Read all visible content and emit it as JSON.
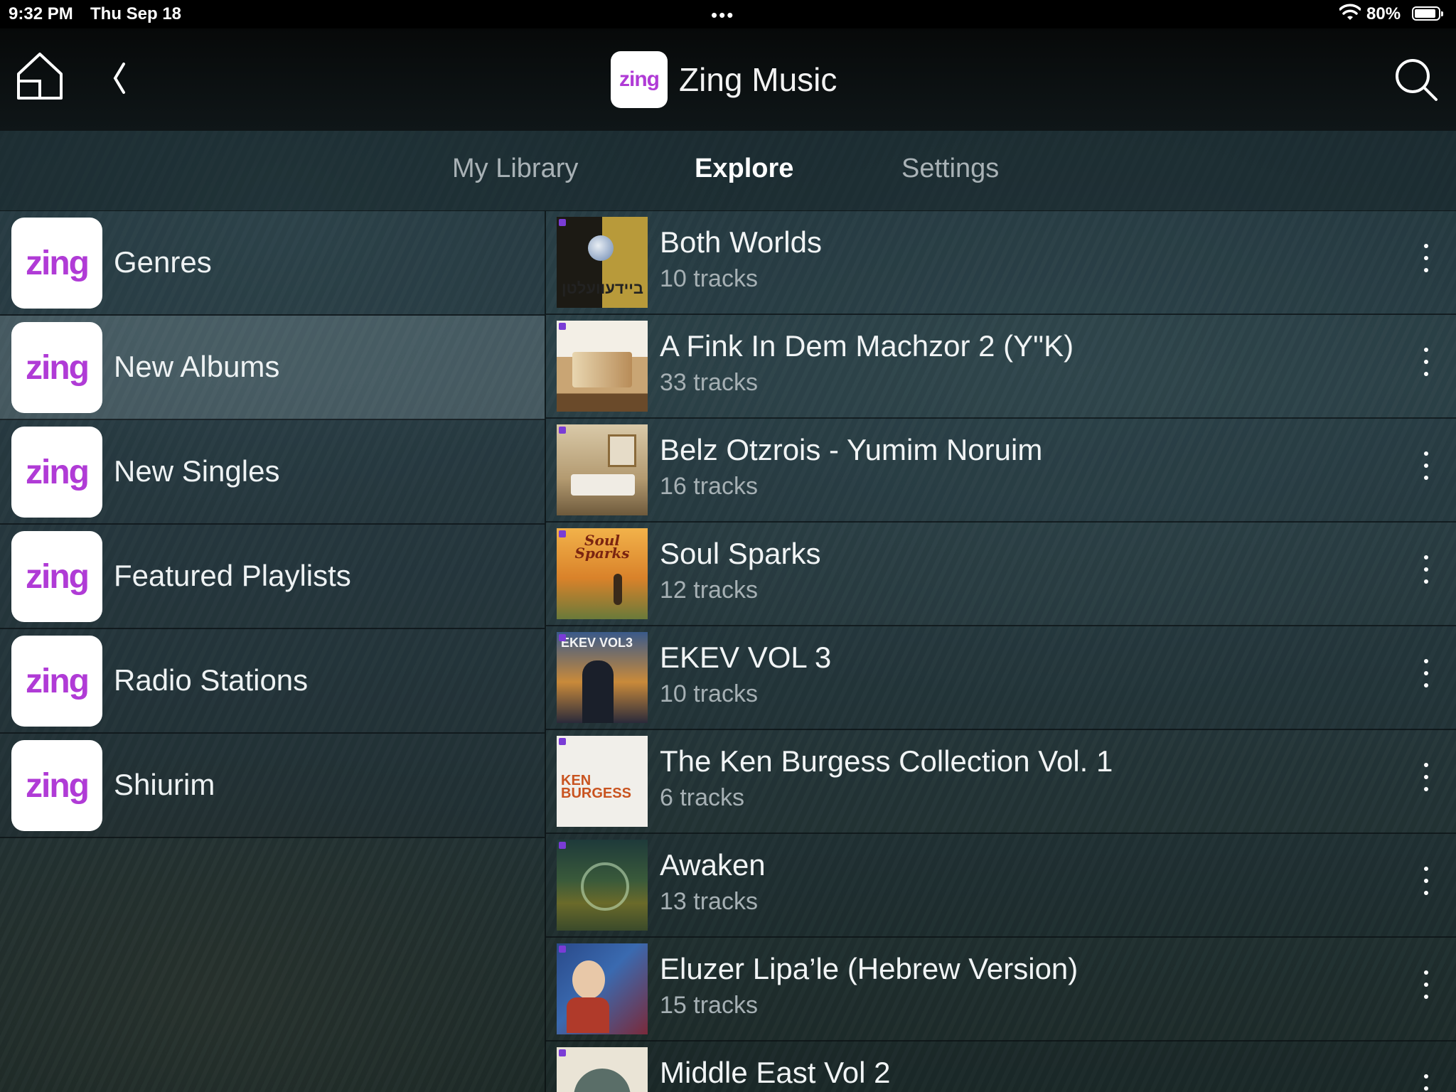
{
  "status_bar": {
    "time": "9:32 PM",
    "date": "Thu Sep 18",
    "dots": "•••",
    "battery": "80%"
  },
  "header": {
    "logo_text": "zing",
    "title": "Zing Music"
  },
  "tabs": [
    {
      "label": "My Library",
      "active": false
    },
    {
      "label": "Explore",
      "active": true
    },
    {
      "label": "Settings",
      "active": false
    }
  ],
  "categories": [
    {
      "logo": "zing",
      "label": "Genres"
    },
    {
      "logo": "zing",
      "label": "New Albums",
      "selected": true
    },
    {
      "logo": "zing",
      "label": "New Singles"
    },
    {
      "logo": "zing",
      "label": "Featured Playlists"
    },
    {
      "logo": "zing",
      "label": "Radio Stations"
    },
    {
      "logo": "zing",
      "label": "Shiurim"
    }
  ],
  "albums": [
    {
      "title": "Both Worlds",
      "tracks": "10 tracks",
      "cover_text": "ביידעוועלטן"
    },
    {
      "title": "A Fink In Dem Machzor 2 (Y\"K)",
      "tracks": "33 tracks",
      "cover_text": ""
    },
    {
      "title": "Belz Otzrois - Yumim Noruim",
      "tracks": "16 tracks",
      "cover_text": ""
    },
    {
      "title": "Soul Sparks",
      "tracks": "12 tracks",
      "cover_text": "Soul Sparks"
    },
    {
      "title": "EKEV VOL 3",
      "tracks": "10 tracks",
      "cover_text": "EKEV VOL3"
    },
    {
      "title": "The Ken Burgess Collection Vol. 1",
      "tracks": "6 tracks",
      "cover_text": "KEN BURGESS"
    },
    {
      "title": "Awaken",
      "tracks": "13 tracks",
      "cover_text": ""
    },
    {
      "title": "Eluzer Lipa’le (Hebrew Version)",
      "tracks": "15 tracks",
      "cover_text": ""
    },
    {
      "title": "Middle East Vol 2",
      "tracks": "",
      "cover_text": ""
    }
  ],
  "colors": {
    "brand": "#b03bd6",
    "background": "#22363d",
    "topbar": "#070909"
  }
}
